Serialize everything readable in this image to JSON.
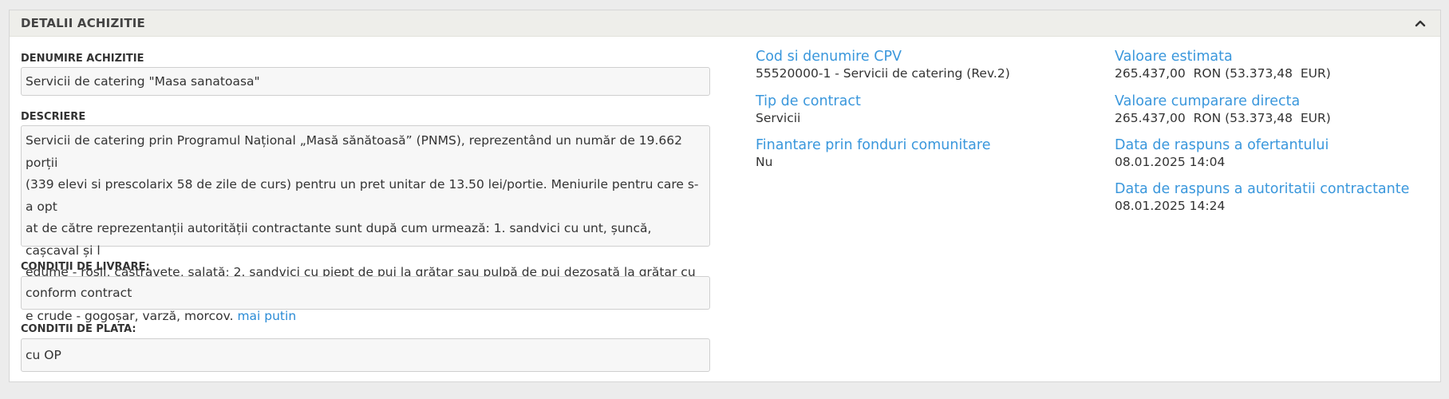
{
  "panel": {
    "title": "DETALII ACHIZITIE"
  },
  "left": {
    "denumire": {
      "label": "DENUMIRE ACHIZITIE",
      "value": "Servicii de catering \"Masa sanatoasa\""
    },
    "descriere": {
      "label": "DESCRIERE",
      "lines": [
        "Servicii de catering prin Programul Național „Masă sănătoasă” (PNMS), reprezentând un număr de 19.662 porții",
        "(339 elevi si prescolarix 58 de zile de curs) pentru un pret unitar de 13.50 lei/portie. Meniurile pentru care s-a opt",
        "at de către reprezentanții autorității contractante sunt după cum urmează: 1. sandvici cu unt, șuncă, cașcaval și l",
        "egume - roșii, castravete, salată; 2. sandvici cu piept de pui la grătar sau pulpă de pui dezosată la grătar cu legum",
        "e crude - gogoșar, varză, morcov. "
      ],
      "more_link": "mai putin"
    },
    "livrare": {
      "label": "CONDITII DE LIVRARE:",
      "value": "conform contract"
    },
    "plata": {
      "label": "CONDITII DE PLATA:",
      "value": "cu OP"
    }
  },
  "middle": {
    "cpv": {
      "label": "Cod si denumire CPV",
      "value": "55520000-1 - Servicii de catering (Rev.2)"
    },
    "tip": {
      "label": "Tip de contract",
      "value": "Servicii"
    },
    "finantare": {
      "label": "Finantare prin fonduri comunitare",
      "value": "Nu"
    }
  },
  "right": {
    "estimata": {
      "label": "Valoare estimata",
      "value": "265.437,00  RON (53.373,48  EUR)"
    },
    "directa": {
      "label": "Valoare cumparare directa",
      "value": "265.437,00  RON (53.373,48  EUR)"
    },
    "ofertant": {
      "label": "Data de raspuns a ofertantului",
      "value": "08.01.2025 14:04"
    },
    "autoritate": {
      "label": "Data de raspuns a autoritatii contractante",
      "value": "08.01.2025 14:24"
    }
  },
  "colors": {
    "link": "#3a97dc",
    "header_bg": "#eeeeea"
  },
  "icons": {
    "collapse": "chevron-up-icon"
  }
}
